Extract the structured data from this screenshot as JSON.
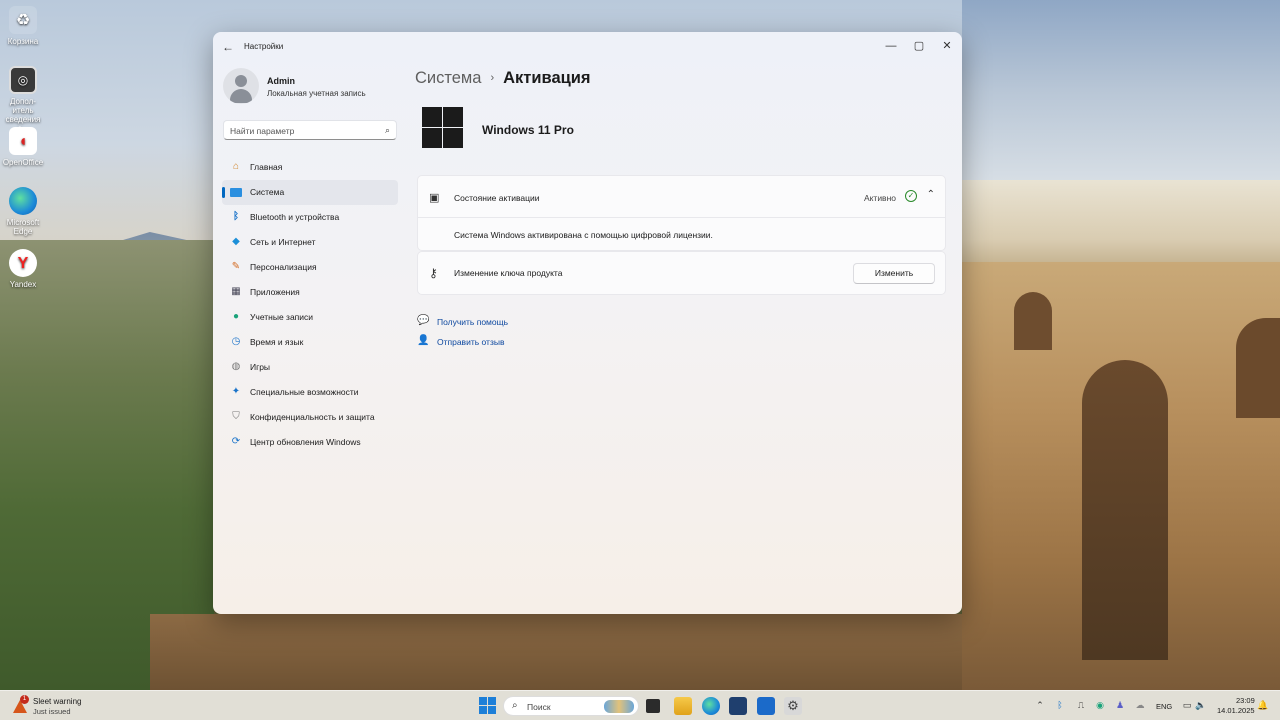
{
  "desktop": {
    "icons": [
      {
        "label": "Корзина",
        "icon": "recycle-bin-icon"
      },
      {
        "label": "Допол-итель сведения о...",
        "icon": "info-shortcut-icon"
      },
      {
        "label": "OpenOffice",
        "icon": "openoffice-icon"
      },
      {
        "label": "Microsoft Edge",
        "icon": "edge-icon"
      },
      {
        "label": "Yandex",
        "icon": "yandex-icon"
      }
    ]
  },
  "window": {
    "title": "Настройки",
    "controls": {
      "minimize": "—",
      "maximize": "▢",
      "close": "✕"
    }
  },
  "profile": {
    "name": "Admin",
    "account_type": "Локальная учетная запись"
  },
  "search": {
    "placeholder": "Найти параметр"
  },
  "nav": {
    "items": [
      {
        "label": "Главная",
        "icon": "home-icon",
        "active": false
      },
      {
        "label": "Система",
        "icon": "system-icon",
        "active": true
      },
      {
        "label": "Bluetooth и устройства",
        "icon": "bluetooth-icon",
        "active": false
      },
      {
        "label": "Сеть и Интернет",
        "icon": "network-icon",
        "active": false
      },
      {
        "label": "Персонализация",
        "icon": "brush-icon",
        "active": false
      },
      {
        "label": "Приложения",
        "icon": "apps-icon",
        "active": false
      },
      {
        "label": "Учетные записи",
        "icon": "accounts-icon",
        "active": false
      },
      {
        "label": "Время и язык",
        "icon": "time-language-icon",
        "active": false
      },
      {
        "label": "Игры",
        "icon": "gaming-icon",
        "active": false
      },
      {
        "label": "Специальные возможности",
        "icon": "accessibility-icon",
        "active": false
      },
      {
        "label": "Конфиденциальность и защита",
        "icon": "shield-icon",
        "active": false
      },
      {
        "label": "Центр обновления Windows",
        "icon": "update-icon",
        "active": false
      }
    ]
  },
  "main": {
    "breadcrumb_parent": "Система",
    "breadcrumb_separator": "›",
    "breadcrumb_current": "Активация",
    "product": "Windows 11 Pro",
    "activation": {
      "title": "Состояние активации",
      "status": "Активно",
      "description": "Система Windows активирована с помощью цифровой лицензии."
    },
    "product_key": {
      "title": "Изменение ключа продукта",
      "button": "Изменить"
    },
    "links": [
      {
        "label": "Получить помощь",
        "icon": "help-icon"
      },
      {
        "label": "Отправить отзыв",
        "icon": "feedback-icon"
      }
    ]
  },
  "taskbar": {
    "notification": {
      "title": "Sleet warning",
      "subtitle": "Just issued",
      "badge": "1"
    },
    "search_placeholder": "Поиск",
    "language": "ENG",
    "time": "23:09",
    "date": "14.01.2025"
  },
  "colors": {
    "accent": "#0067c0",
    "link": "#0f4aa0",
    "success": "#2b8a2b"
  }
}
